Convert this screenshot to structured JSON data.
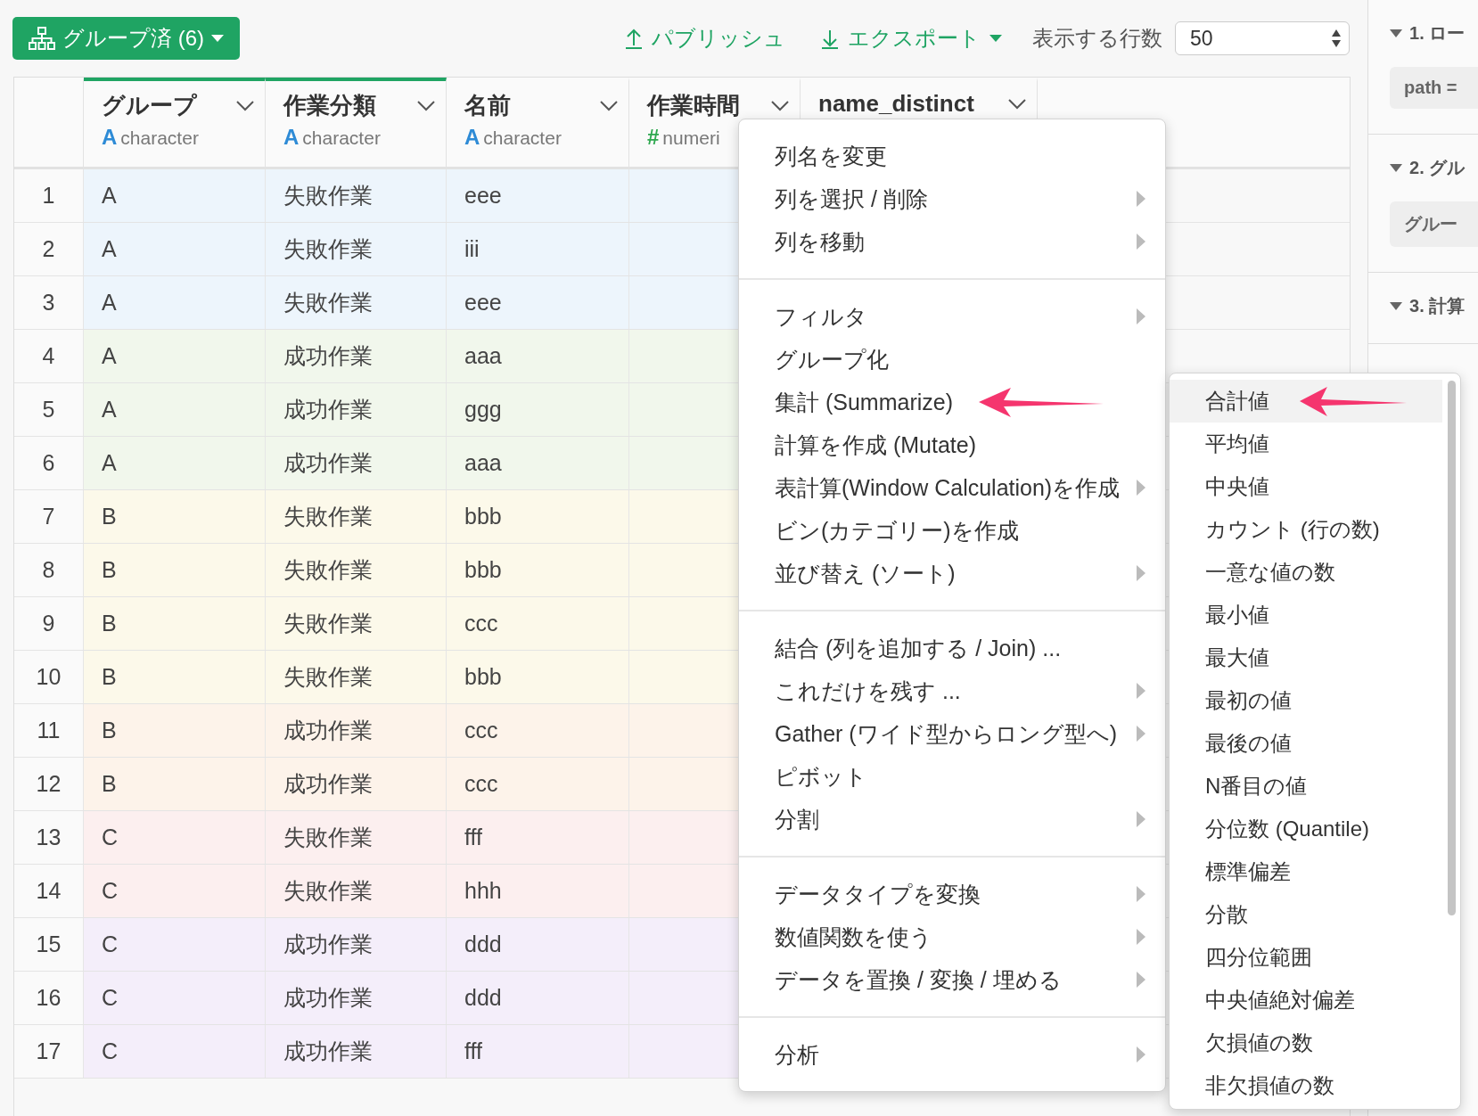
{
  "toolbar": {
    "group_button": "グループ済 (6)",
    "publish": "パブリッシュ",
    "export": "エクスポート",
    "rows_label": "表示する行数",
    "rows_value": "50"
  },
  "table": {
    "columns": [
      {
        "name": "グループ",
        "type_icon": "A",
        "color": "#2e8bd6",
        "type_label": "character",
        "grouped": true
      },
      {
        "name": "作業分類",
        "type_icon": "A",
        "color": "#2e8bd6",
        "type_label": "character",
        "grouped": true
      },
      {
        "name": "名前",
        "type_icon": "A",
        "color": "#2e8bd6",
        "type_label": "character",
        "grouped": false
      },
      {
        "name": "作業時間",
        "type_icon": "#",
        "color": "#2ea84f",
        "type_label": "numeri",
        "grouped": false
      },
      {
        "name": "name_distinct",
        "grouped": false
      }
    ],
    "rows": [
      {
        "number": "1",
        "cells": [
          "A",
          "失敗作業",
          "eee"
        ],
        "color": "#edf5fc"
      },
      {
        "number": "2",
        "cells": [
          "A",
          "失敗作業",
          "iii"
        ],
        "color": "#edf5fc"
      },
      {
        "number": "3",
        "cells": [
          "A",
          "失敗作業",
          "eee"
        ],
        "color": "#edf5fc"
      },
      {
        "number": "4",
        "cells": [
          "A",
          "成功作業",
          "aaa"
        ],
        "color": "#f1f7ec"
      },
      {
        "number": "5",
        "cells": [
          "A",
          "成功作業",
          "ggg"
        ],
        "color": "#f1f7ec"
      },
      {
        "number": "6",
        "cells": [
          "A",
          "成功作業",
          "aaa"
        ],
        "color": "#f1f7ec"
      },
      {
        "number": "7",
        "cells": [
          "B",
          "失敗作業",
          "bbb"
        ],
        "color": "#fcf9ea"
      },
      {
        "number": "8",
        "cells": [
          "B",
          "失敗作業",
          "bbb"
        ],
        "color": "#fcf9ea"
      },
      {
        "number": "9",
        "cells": [
          "B",
          "失敗作業",
          "ccc"
        ],
        "color": "#fcf9ea"
      },
      {
        "number": "10",
        "cells": [
          "B",
          "失敗作業",
          "bbb"
        ],
        "color": "#fcf9ea"
      },
      {
        "number": "11",
        "cells": [
          "B",
          "成功作業",
          "ccc"
        ],
        "color": "#fdf3ea"
      },
      {
        "number": "12",
        "cells": [
          "B",
          "成功作業",
          "ccc"
        ],
        "color": "#fdf3ea"
      },
      {
        "number": "13",
        "cells": [
          "C",
          "失敗作業",
          "fff"
        ],
        "color": "#fcefef"
      },
      {
        "number": "14",
        "cells": [
          "C",
          "失敗作業",
          "hhh"
        ],
        "color": "#fcefef"
      },
      {
        "number": "15",
        "cells": [
          "C",
          "成功作業",
          "ddd"
        ],
        "color": "#f4eefa"
      },
      {
        "number": "16",
        "cells": [
          "C",
          "成功作業",
          "ddd"
        ],
        "color": "#f4eefa"
      },
      {
        "number": "17",
        "cells": [
          "C",
          "成功作業",
          "fff"
        ],
        "color": "#f4eefa"
      }
    ]
  },
  "column_menu": {
    "sections": [
      [
        {
          "label": "列名を変更",
          "has_submenu": false
        },
        {
          "label": "列を選択 / 削除",
          "has_submenu": true
        },
        {
          "label": "列を移動",
          "has_submenu": true
        }
      ],
      [
        {
          "label": "フィルタ",
          "has_submenu": true
        },
        {
          "label": "グループ化",
          "has_submenu": false
        },
        {
          "label": "集計 (Summarize)",
          "has_submenu": false
        },
        {
          "label": "計算を作成 (Mutate)",
          "has_submenu": false
        },
        {
          "label": "表計算(Window Calculation)を作成",
          "has_submenu": true
        },
        {
          "label": "ビン(カテゴリー)を作成",
          "has_submenu": false
        },
        {
          "label": "並び替え (ソート)",
          "has_submenu": true
        }
      ],
      [
        {
          "label": "結合 (列を追加する / Join) ...",
          "has_submenu": false
        },
        {
          "label": "これだけを残す ...",
          "has_submenu": true
        },
        {
          "label": "Gather (ワイド型からロング型へ)",
          "has_submenu": true
        },
        {
          "label": "ピボット",
          "has_submenu": false
        },
        {
          "label": "分割",
          "has_submenu": true
        }
      ],
      [
        {
          "label": "データタイプを変換",
          "has_submenu": true
        },
        {
          "label": "数値関数を使う",
          "has_submenu": true
        },
        {
          "label": "データを置換 / 変換 / 埋める",
          "has_submenu": true
        }
      ],
      [
        {
          "label": "分析",
          "has_submenu": true
        }
      ]
    ]
  },
  "submenu": {
    "items": [
      {
        "label": "合計値",
        "selected": true
      },
      {
        "label": "平均値",
        "selected": false
      },
      {
        "label": "中央値",
        "selected": false
      },
      {
        "label": "カウント (行の数)",
        "selected": false
      },
      {
        "label": "一意な値の数",
        "selected": false
      },
      {
        "label": "最小値",
        "selected": false
      },
      {
        "label": "最大値",
        "selected": false
      },
      {
        "label": "最初の値",
        "selected": false
      },
      {
        "label": "最後の値",
        "selected": false
      },
      {
        "label": "N番目の値",
        "selected": false
      },
      {
        "label": "分位数 (Quantile)",
        "selected": false
      },
      {
        "label": "標準偏差",
        "selected": false
      },
      {
        "label": "分散",
        "selected": false
      },
      {
        "label": "四分位範囲",
        "selected": false
      },
      {
        "label": "中央値絶対偏差",
        "selected": false
      },
      {
        "label": "欠損値の数",
        "selected": false
      },
      {
        "label": "非欠損値の数",
        "selected": false
      }
    ]
  },
  "sidebar": {
    "steps": [
      {
        "title": "1. ロー",
        "chips": [
          "path ="
        ]
      },
      {
        "title": "2. グル",
        "chips": [
          "グルー"
        ]
      },
      {
        "title": "3. 計算"
      }
    ]
  }
}
